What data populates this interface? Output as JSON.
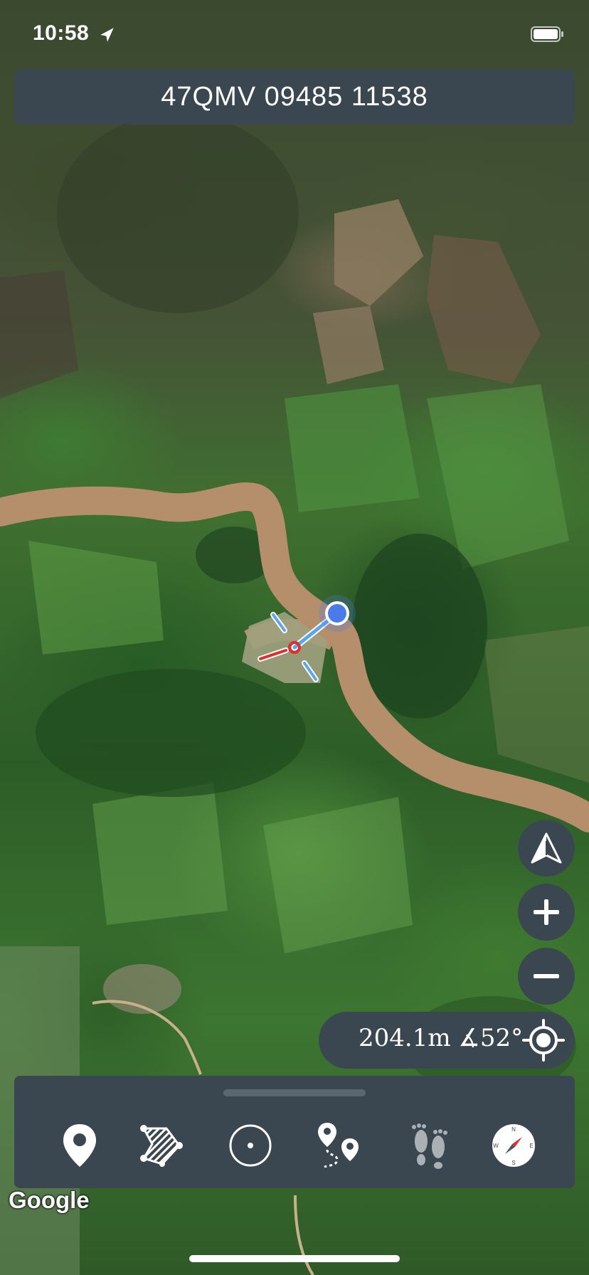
{
  "status_bar": {
    "time": "10:58",
    "location_arrow_icon": "location-arrow-icon",
    "battery_icon": "battery-icon"
  },
  "coordinate_bar": {
    "text": "47QMV 09485 11538"
  },
  "map": {
    "attribution": "Google",
    "river_color": "#b58e6b",
    "user_location_color": "#4a7be8"
  },
  "controls": {
    "orientation_icon": "north-up-icon",
    "zoom_in_icon": "plus-icon",
    "zoom_out_icon": "minus-icon"
  },
  "measurement": {
    "text": "204.1m ∡52°",
    "locate_icon": "crosshair-icon"
  },
  "toolbar": {
    "tools": [
      {
        "name": "pin",
        "icon": "map-pin-icon"
      },
      {
        "name": "polygon",
        "icon": "polygon-area-icon"
      },
      {
        "name": "circle",
        "icon": "circle-icon"
      },
      {
        "name": "route",
        "icon": "route-icon"
      },
      {
        "name": "track",
        "icon": "footprints-icon"
      },
      {
        "name": "compass",
        "icon": "compass-icon"
      }
    ]
  },
  "colors": {
    "panel": "#3b4750",
    "text": "#ffffff"
  }
}
